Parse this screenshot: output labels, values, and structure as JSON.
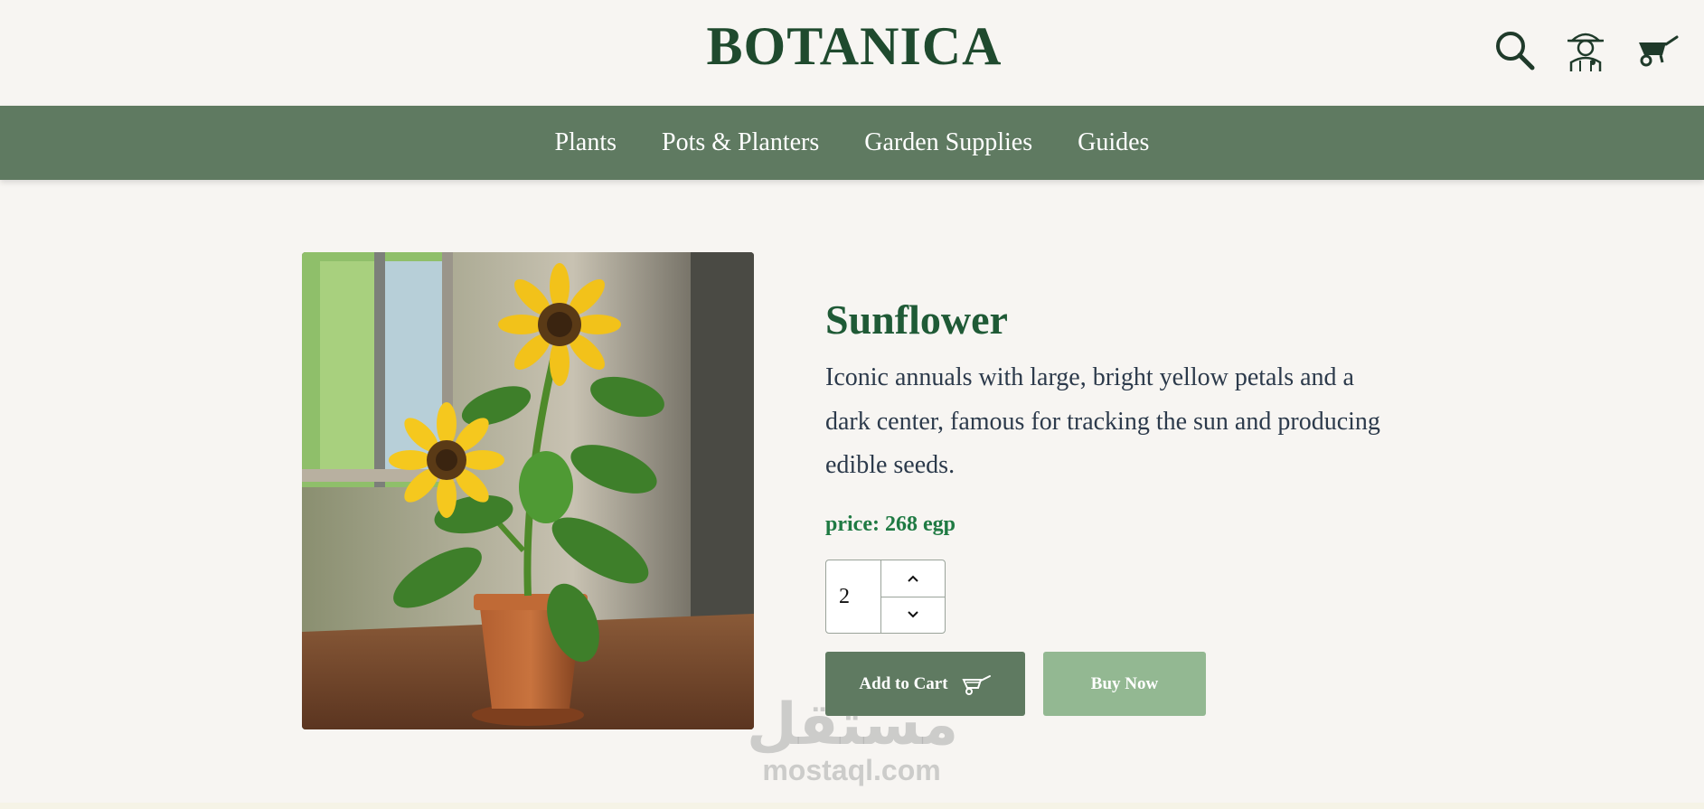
{
  "brand": {
    "logo_text": "BOTANICA"
  },
  "header": {
    "icons": [
      "search-icon",
      "gardener-account-icon",
      "wheelbarrow-cart-icon"
    ]
  },
  "nav": {
    "items": [
      {
        "label": "Plants"
      },
      {
        "label": "Pots & Planters"
      },
      {
        "label": "Garden Supplies"
      },
      {
        "label": "Guides"
      }
    ]
  },
  "product": {
    "image_alt": "sunflower in terracotta pot",
    "name": "Sunflower",
    "description": "Iconic annuals with large, bright yellow petals and a dark center, famous for tracking the sun and producing edible seeds.",
    "price_text": "price: 268 egp",
    "quantity": "2",
    "add_to_cart_label": "Add to Cart",
    "buy_now_label": "Buy Now"
  },
  "watermark": {
    "arabic": "مستقل",
    "latin": "mostaql.com"
  },
  "colors": {
    "background": "#f7f5f2",
    "nav_bg": "#5f7a61",
    "brand_green": "#1f4a2e",
    "price_green": "#1f7a43",
    "buy_button": "#93b892"
  }
}
